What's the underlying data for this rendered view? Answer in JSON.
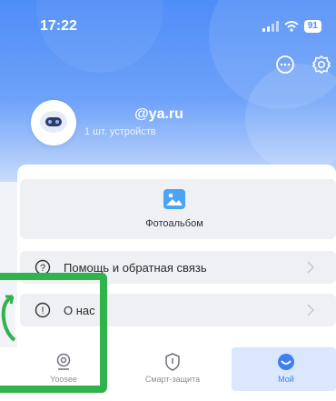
{
  "status_bar": {
    "time": "17:22",
    "battery": "91"
  },
  "header": {
    "email": "@ya.ru",
    "devices": "1 шт. устройств",
    "message_icon": "message-bubble-icon",
    "settings_icon": "gear-icon",
    "avatar_icon": "robot-avatar-icon"
  },
  "content": {
    "album_label": "Фотоальбом",
    "album_icon": "photo-album-icon",
    "help_label": "Помощь и обратная связь",
    "about_label": "О нас"
  },
  "tabbar": {
    "tabs": [
      {
        "label": "Yoosee",
        "icon": "camera-icon",
        "active": false
      },
      {
        "label": "Смарт-защита",
        "icon": "shield-icon",
        "active": false
      },
      {
        "label": "Мой",
        "icon": "profile-icon",
        "active": true
      }
    ]
  },
  "colors": {
    "accent": "#4f8df7",
    "highlight": "#2fb34a",
    "row_background": "#eef0f3"
  }
}
